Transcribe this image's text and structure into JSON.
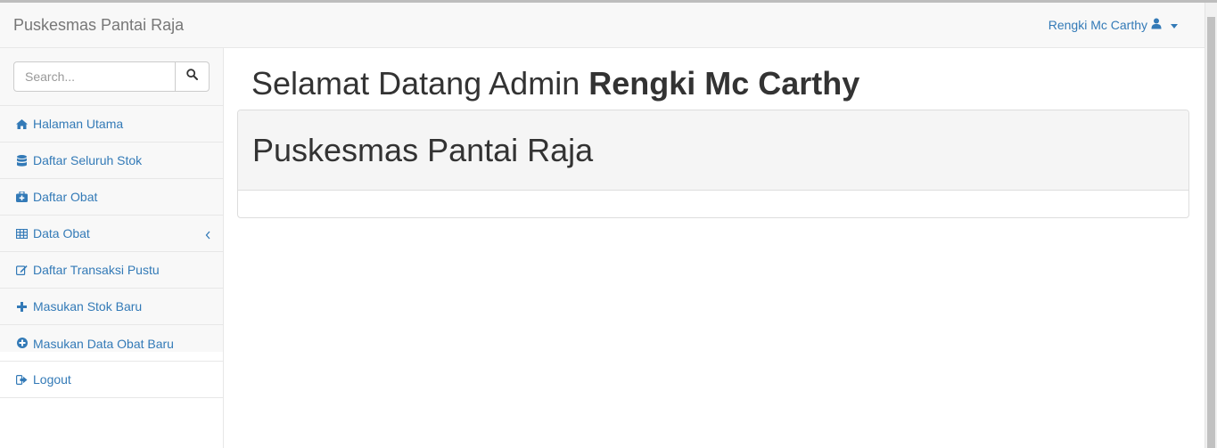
{
  "navbar": {
    "brand": "Puskesmas Pantai Raja",
    "user_name": "Rengki Mc Carthy",
    "user_icon": "user-icon",
    "dropdown_icon": "caret-down-icon"
  },
  "search": {
    "placeholder": "Search...",
    "button_icon": "search-icon"
  },
  "sidebar": {
    "items": [
      {
        "label": "Halaman Utama",
        "icon": "home-icon"
      },
      {
        "label": "Daftar Seluruh Stok",
        "icon": "database-icon"
      },
      {
        "label": "Daftar Obat",
        "icon": "medkit-icon"
      },
      {
        "label": "Data Obat",
        "icon": "table-icon",
        "expand_icon": "chevron-left-icon"
      },
      {
        "label": "Daftar Transaksi Pustu",
        "icon": "edit-icon"
      },
      {
        "label": "Masukan Stok Baru",
        "icon": "plus-icon"
      },
      {
        "label": "Masukan Data Obat Baru",
        "icon": "plus-circle-icon"
      },
      {
        "label": "Logout",
        "icon": "sign-out-icon"
      }
    ]
  },
  "main": {
    "welcome_prefix": "Selamat Datang Admin",
    "welcome_name": "Rengki Mc Carthy",
    "panel_heading": "Puskesmas Pantai Raja"
  },
  "colors": {
    "link": "#337ab7",
    "navbar_bg": "#f8f8f8",
    "panel_heading_bg": "#f5f5f5",
    "border": "#e7e7e7"
  }
}
